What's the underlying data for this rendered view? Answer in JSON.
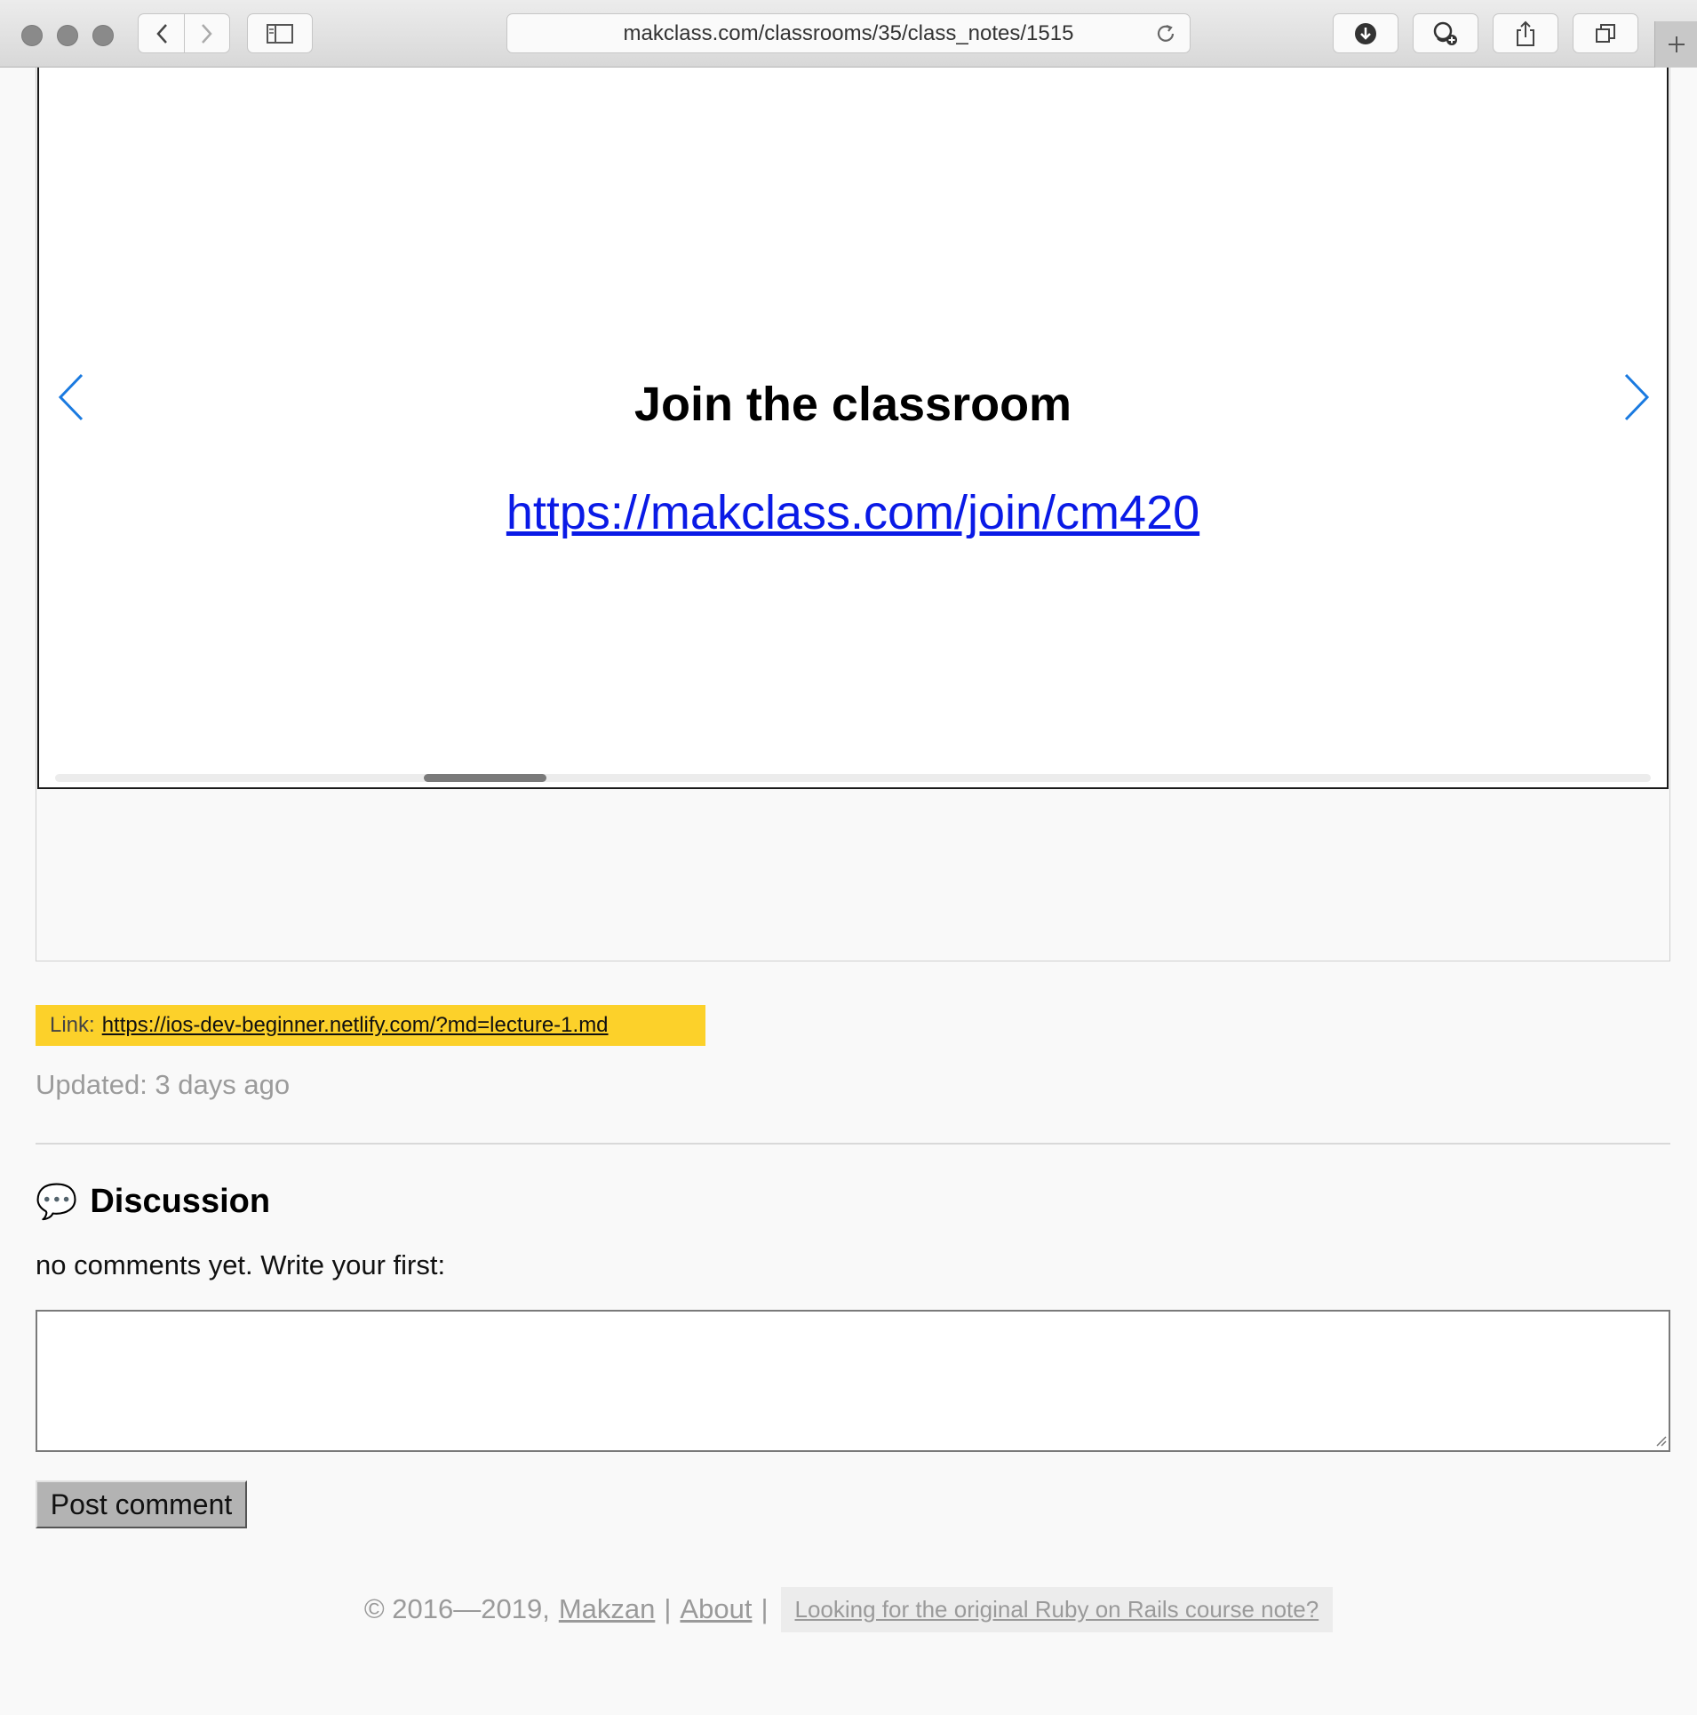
{
  "browser": {
    "url": "makclass.com/classrooms/35/class_notes/1515"
  },
  "slide": {
    "title": "Join the classroom",
    "link": "https://makclass.com/join/cm420"
  },
  "note": {
    "link_label": "Link:",
    "link_url": "https://ios-dev-beginner.netlify.com/?md=lecture-1.md",
    "updated": "Updated: 3 days ago"
  },
  "discussion": {
    "emoji": "💬",
    "title": "Discussion",
    "empty_text": "no comments yet. Write your first:",
    "comment_value": "",
    "post_label": "Post comment"
  },
  "footer": {
    "copyright": "© 2016—2019,",
    "author": "Makzan",
    "about": "About",
    "separator": "|",
    "rails_note": "Looking for the original Ruby on Rails course note?"
  },
  "colors": {
    "accent_link": "#0a1ae6",
    "arrow_blue": "#1a7ae0",
    "badge_yellow": "#fcd12a"
  }
}
